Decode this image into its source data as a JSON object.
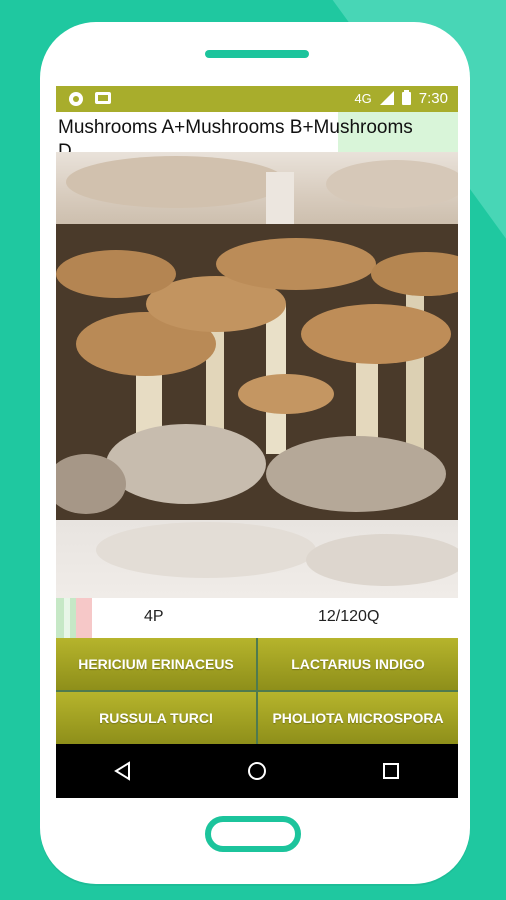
{
  "statusbar": {
    "time": "7:30",
    "network": "4G",
    "icons": [
      "message-icon",
      "notification-icon",
      "signal-icon",
      "battery-icon"
    ]
  },
  "title": {
    "line1": "Mushrooms A+Mushrooms B+Mushrooms",
    "line2": "D"
  },
  "score": {
    "points": "4P",
    "question": "12/120Q"
  },
  "answers": [
    {
      "label": "HERICIUM ERINACEUS"
    },
    {
      "label": "LACTARIUS INDIGO"
    },
    {
      "label": "RUSSULA TURCI"
    },
    {
      "label": "PHOLIOTA MICROSPORA"
    }
  ],
  "colors": {
    "background": "#1fc8a0",
    "statusbar": "#a8ad2c",
    "button": "#9ea222"
  }
}
